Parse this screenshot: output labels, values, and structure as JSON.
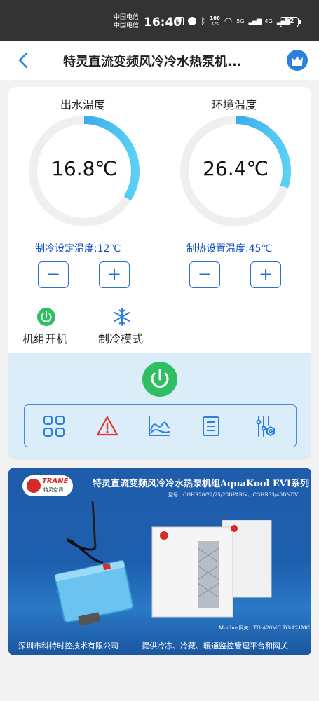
{
  "status_bar": {
    "carrier_1": "中国电信",
    "carrier_2": "中国电信",
    "time": "16:40",
    "net_speed_value": "106",
    "net_speed_unit": "K/s",
    "signal_1": "5G",
    "signal_2": "4G",
    "battery": "92"
  },
  "header": {
    "title": "特灵直流变频风冷冷水热泵机...",
    "back_icon": "chevron-left-icon",
    "vip_icon": "crown-icon"
  },
  "gauges": {
    "outlet": {
      "label": "出水温度",
      "value": "16.8℃",
      "level": 0.34
    },
    "ambient": {
      "label": "环境温度",
      "value": "26.4℃",
      "level": 0.3
    }
  },
  "setpoints": {
    "cooling": {
      "label": "制冷设定温度:12℃",
      "minus": "−",
      "plus": "+"
    },
    "heating": {
      "label": "制热设置温度:45℃",
      "minus": "−",
      "plus": "+"
    }
  },
  "modes": {
    "unit_on": {
      "label": "机组开机",
      "icon": "power-icon"
    },
    "cooling_mode": {
      "label": "制冷模式",
      "icon": "snowflake-icon"
    }
  },
  "controls": {
    "power_icon": "power-button-icon",
    "func_icons": [
      "grid-icon",
      "warning-icon",
      "chart-icon",
      "list-icon",
      "settings-sliders-icon"
    ]
  },
  "banner": {
    "brand": "TRANE",
    "brand_cn": "特灵空调",
    "title": "特灵直流变频风冷冷水热泵机组AquaKool EVI系列",
    "model": "型号：CGHR20/22/25/28DPAR/V、CGHR33/40DNDV",
    "gateway": "Modbus网关：TG-A20MC TG-A21MC",
    "company": "深圳市科特时控技术有限公司",
    "slogan": "提供冷冻、冷藏、暖通监控管理平台和网关"
  },
  "colors": {
    "accent_blue": "#2b6fd6",
    "gauge_gradient_start": "#1e86e0",
    "gauge_gradient_end": "#5ad0f5",
    "power_green": "#2fbf63",
    "warning_red": "#e3342f",
    "control_bg": "#dcedfa"
  }
}
